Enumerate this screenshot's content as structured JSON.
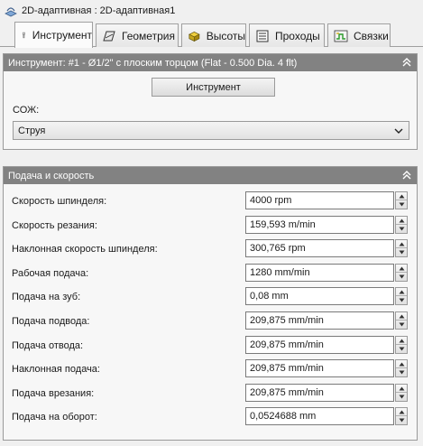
{
  "window": {
    "title": "2D-адаптивная : 2D-адаптивная1"
  },
  "tabs": [
    {
      "label": "Инструмент",
      "icon": "tool-holder-icon",
      "active": true
    },
    {
      "label": "Геометрия",
      "icon": "geometry-icon",
      "active": false
    },
    {
      "label": "Высоты",
      "icon": "heights-icon",
      "active": false
    },
    {
      "label": "Проходы",
      "icon": "passes-icon",
      "active": false
    },
    {
      "label": "Связки",
      "icon": "linking-icon",
      "active": false
    }
  ],
  "tool_section": {
    "header": "Инструмент: #1 - Ø1/2\" с плоским торцом (Flat - 0.500 Dia. 4 flt)",
    "button_label": "Инструмент",
    "coolant_label": "СОЖ:",
    "coolant_value": "Струя"
  },
  "feed_section": {
    "header": "Подача и скорость",
    "rows": [
      {
        "label": "Скорость шпинделя:",
        "value": "4000",
        "unit": "rpm"
      },
      {
        "label": "Скорость резания:",
        "value": "159,593",
        "unit": "m/min"
      },
      {
        "label": "Наклонная скорость шпинделя:",
        "value": "300,765",
        "unit": "rpm"
      },
      {
        "label": "Рабочая подача:",
        "value": "1280",
        "unit": "mm/min"
      },
      {
        "label": "Подача на зуб:",
        "value": "0,08",
        "unit": "mm"
      },
      {
        "label": "Подача подвода:",
        "value": "209,875",
        "unit": "mm/min"
      },
      {
        "label": "Подача отвода:",
        "value": "209,875",
        "unit": "mm/min"
      },
      {
        "label": "Наклонная подача:",
        "value": "209,875",
        "unit": "mm/min"
      },
      {
        "label": "Подача врезания:",
        "value": "209,875",
        "unit": "mm/min"
      },
      {
        "label": "Подача на оборот:",
        "value": "0,0524688",
        "unit": "mm"
      }
    ]
  },
  "colors": {
    "panel_header": "#828282",
    "background": "#f0f0f0"
  }
}
